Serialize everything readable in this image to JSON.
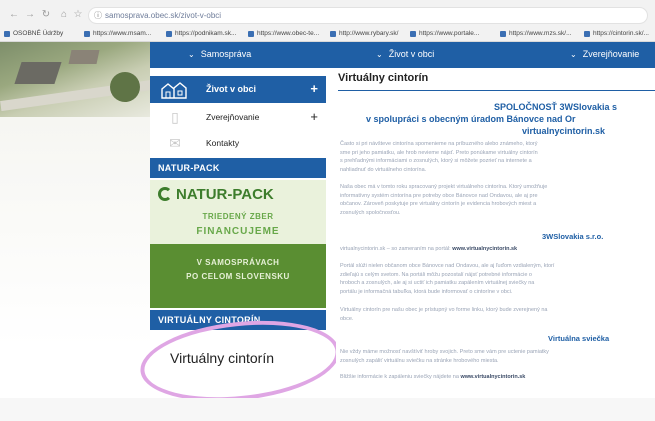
{
  "browser": {
    "url": "samosprava.obec.sk/zivot-v-obci",
    "bookmarks": [
      {
        "label": "OSOBNÉ Údržby"
      },
      {
        "label": "https://www.msam..."
      },
      {
        "label": "https://podnikam.sk..."
      },
      {
        "label": "https://www.obec-te..."
      },
      {
        "label": "http://www.rybary.sk/"
      },
      {
        "label": "https://www.portale..."
      },
      {
        "label": "https://www.mzs.sk/..."
      },
      {
        "label": "https://cintorin.sk/..."
      }
    ]
  },
  "topnav": {
    "items": [
      "Samospráva",
      "Život v obci",
      "Zverejňovanie"
    ]
  },
  "sidebar": {
    "active_item": "Život v obci",
    "items": [
      "Zverejňovanie",
      "Kontakty"
    ],
    "section_natur": "NATUR-PACK",
    "banner": {
      "logo": "NATUR-PACK",
      "line1": "TRIEDENÝ ZBER",
      "line2": "FINANCUJEME",
      "line3": "V SAMOSPRÁVACH",
      "line4": "PO CELOM SLOVENSKU"
    },
    "section_vc": "VIRTUÁLNY CINTORÍN",
    "vc_link": "Virtuálny cintorín"
  },
  "main": {
    "title": "Virtuálny cintorín",
    "headline_1": "SPOLOČNOSŤ 3WSlovakia s",
    "headline_2": "v spolupráci  s obecným úradom Bánovce nad Or",
    "headline_3": "virtualnycintorin.sk",
    "para1": [
      "Často si pri návšteve cintorína spomenieme na príbuzného alebo známeho, ktorý",
      "sme pri jeho pamiatku, ale hrob nevieme nájsť. Preto ponúkame virtuálny cintorín",
      "s prehľadnými informáciami o zosnulých, ktorý si môžete pozrieť na internete a",
      "nahliadnuť do virtuálneho cintorína."
    ],
    "para2": [
      "Naša obec má v tomto roku spracovaný projekt virtuálneho cintorína. Ktorý umožňuje",
      "informatívny systém cintorína pre potreby obce Bánovce nad Ondavou, ale aj pre",
      "občanov. Zároveň poskytuje pre virtuálny cintorín je evidencia hrobových miest a",
      "zosnulých spoločnosťou."
    ],
    "company": "3WSlovakia s.r.o.",
    "link_line_prefix": "virtualnycintorin.sk – so zameraním na portál:",
    "link_line_url": "www.virtualnycintorin.sk",
    "para3": [
      "Portál slúži nielen občanom obce Bánovce nad Ondavou, ale aj ľuďom vzdialeným, ktorí",
      "zdieľajú s celým svetom. Na portáli môžu pozostalí nájsť potrebné informácie o",
      "hroboch a zosnulých, ale aj si uctiť ich pamiatku zapálením virtuálnej sviečky na",
      "portálu je informačná tabuľka, ktorá bude informovať o cintoríne v obci."
    ],
    "para4": [
      "Virtuálny cintorín pre našu obec je prístupný vo forme linku, ktorý bude zverejnený na",
      "obce."
    ],
    "candle_heading": "Virtuálna sviečka",
    "para5": [
      "Nie vždy máme možnosť navštíviť hroby svojich. Preto sme vám pre uctenie pamiatky",
      "zosnulých zapáliť virtuálnu sviečku na stránke hrobového miesta."
    ],
    "more_prefix": "Bližšie informácie k zapáleniu sviečky nájdete na",
    "more_url": "www.virtualnycintorin.sk"
  },
  "colors": {
    "brand_blue": "#1f5fa5",
    "natur_green": "#3d7d2c",
    "highlight_circle": "#dfa6e4"
  }
}
